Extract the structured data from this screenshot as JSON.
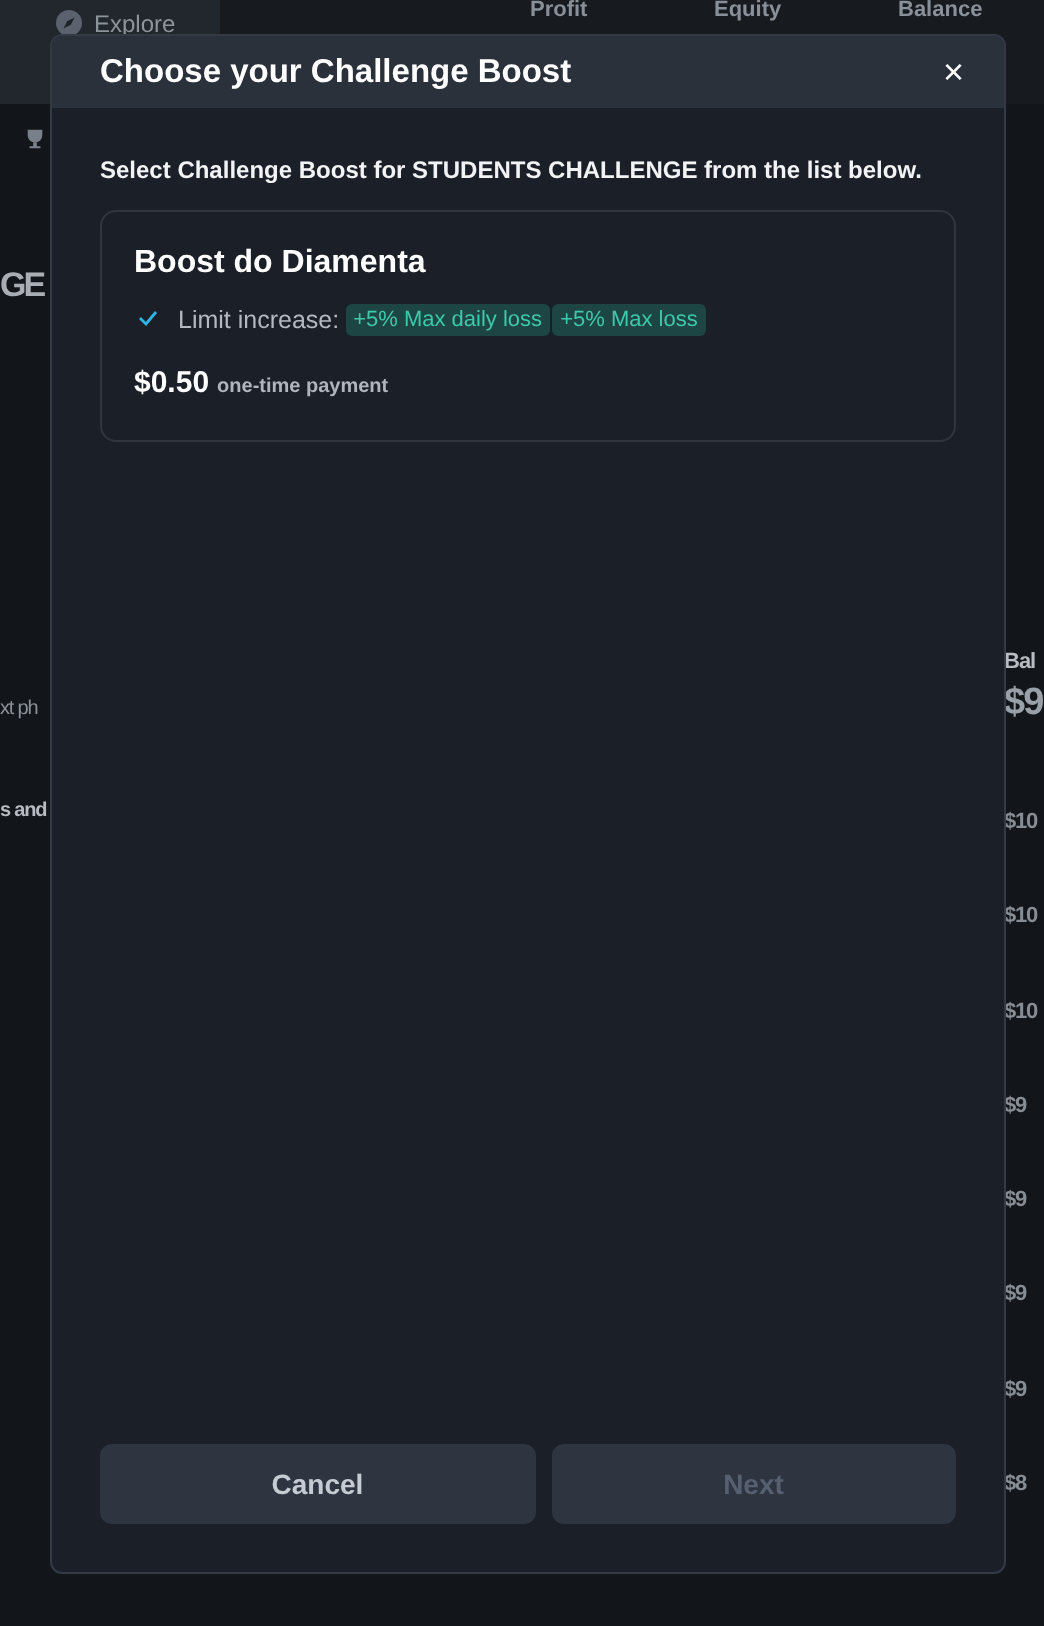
{
  "background": {
    "top_tab": "Explore",
    "stats": [
      {
        "label": "Profit"
      },
      {
        "label": "Equity"
      },
      {
        "label": "Balance"
      }
    ],
    "left_fragments": [
      "GE",
      "xt ph",
      "s and"
    ],
    "right_title": "Bal",
    "right_value": "$9",
    "right_rows": [
      "$10",
      "$10",
      "$10",
      "$9",
      "$9",
      "$9",
      "$9",
      "$8"
    ]
  },
  "modal": {
    "title": "Choose your Challenge Boost",
    "close": "×",
    "intro": "Select Challenge Boost for STUDENTS CHALLENGE from the list below.",
    "boosts": [
      {
        "name": "Boost do Diamenta",
        "features": [
          {
            "label": "Limit increase:",
            "tags": [
              "+5% Max daily loss",
              "+5% Max loss"
            ]
          }
        ],
        "price": "$0.50",
        "price_note": "one-time payment"
      }
    ],
    "buttons": [
      {
        "label": "Cancel",
        "disabled": false
      },
      {
        "label": "Next",
        "disabled": true
      }
    ]
  }
}
